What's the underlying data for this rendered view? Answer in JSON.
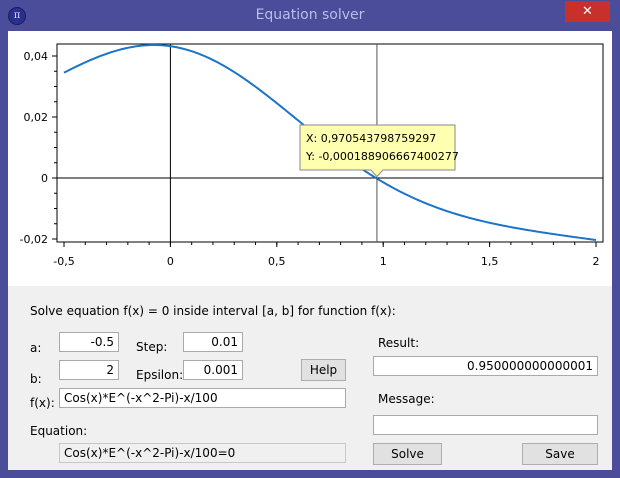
{
  "window": {
    "title": "Equation solver",
    "icon_glyph": "π",
    "close_glyph": "✕"
  },
  "chart_data": {
    "type": "line",
    "function": "Cos(x)*E^(-x^2-Pi)-x/100",
    "xlim": [
      -0.5,
      2
    ],
    "ylim": [
      -0.02,
      0.043
    ],
    "x_ticks": [
      "-0,5",
      "0",
      "0,5",
      "1",
      "1,5",
      "2"
    ],
    "y_ticks": [
      "0,04",
      "0,02",
      "0",
      "-0,02"
    ],
    "x_tick_values": [
      -0.5,
      0,
      0.5,
      1,
      1.5,
      2
    ],
    "y_tick_values": [
      0.04,
      0.02,
      0,
      -0.02
    ],
    "cursor": {
      "x": 0.970543798759297,
      "y": -0.000188906667400277
    },
    "tooltip": {
      "x_text": "X: 0,970543798759297",
      "y_text": "Y: -0,000188906667400277"
    },
    "line_color": "#1c74c9"
  },
  "form": {
    "instruction": "Solve equation f(x) = 0 inside interval [a, b] for function f(x):",
    "a_label": "a:",
    "a_value": "-0.5",
    "b_label": "b:",
    "b_value": "2",
    "step_label": "Step:",
    "step_value": "0.01",
    "epsilon_label": "Epsilon:",
    "epsilon_value": "0.001",
    "help_label": "Help",
    "fx_label": "f(x):",
    "fx_value": "Cos(x)*E^(-x^2-Pi)-x/100",
    "equation_label": "Equation:",
    "equation_value": "Cos(x)*E^(-x^2-Pi)-x/100=0",
    "result_label": "Result:",
    "result_value": "0.950000000000001",
    "message_label": "Message:",
    "message_value": "",
    "solve_label": "Solve",
    "save_label": "Save"
  }
}
